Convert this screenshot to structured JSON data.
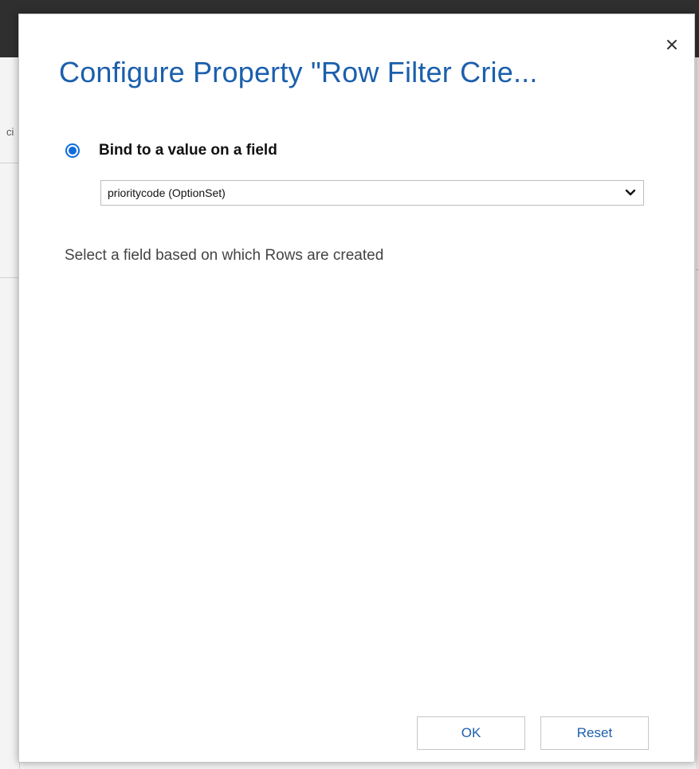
{
  "background": {
    "left_snippet": "ci"
  },
  "dialog": {
    "title": "Configure Property \"Row Filter Crie...",
    "close_icon": "close-icon",
    "binding_option": {
      "label": "Bind to a value on a field",
      "selected": true
    },
    "field_select": {
      "value": "prioritycode (OptionSet)",
      "icon": "chevron-down-icon"
    },
    "help_text": "Select a field based on which Rows are created",
    "buttons": {
      "ok": "OK",
      "reset": "Reset"
    }
  },
  "colors": {
    "title": "#1b5fac",
    "radio": "#0f6cde",
    "button_text": "#1b5fac"
  }
}
